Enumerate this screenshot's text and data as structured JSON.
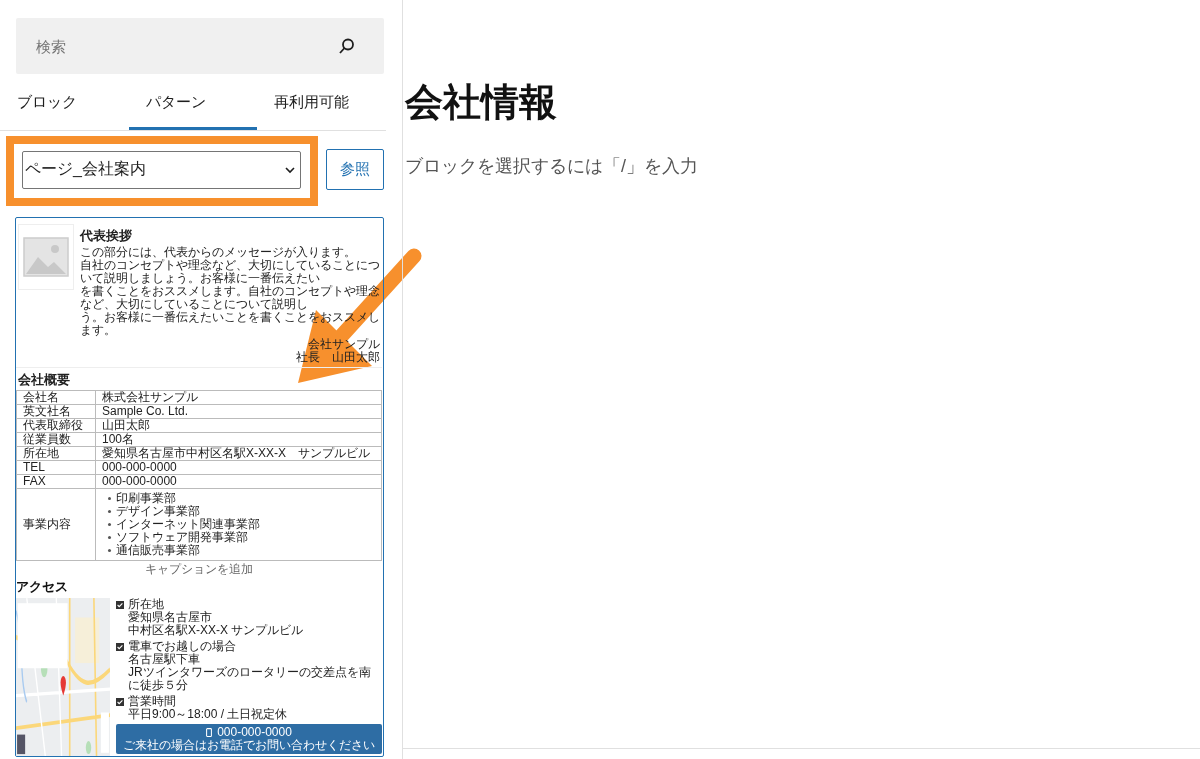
{
  "search": {
    "placeholder": "検索"
  },
  "tabs": [
    {
      "label": "ブロック",
      "selected": false
    },
    {
      "label": "パターン",
      "selected": true
    },
    {
      "label": "再利用可能",
      "selected": false
    }
  ],
  "pattern_category": {
    "value": "ページ_会社案内",
    "highlighted": true
  },
  "browse_button": "参照",
  "pattern_preview": {
    "pointed_at": true,
    "greeting": {
      "title": "代表挨拶",
      "paragraphs": [
        "この部分には、代表からのメッセージが入ります。",
        "自社のコンセプトや理念など、大切にしていることについて説明しましょう。お客様に一番伝えたい",
        "を書くことをおススメします。自社のコンセプトや理念など、大切にしていることについて説明し",
        "う。お客様に一番伝えたいことを書くことをおススメします。"
      ],
      "signature": [
        "会社サンプル",
        "社長　山田太郎"
      ]
    },
    "overview": {
      "title": "会社概要",
      "rows": [
        {
          "label": "会社名",
          "value": "株式会社サンプル"
        },
        {
          "label": "英文社名",
          "value": "Sample Co. Ltd."
        },
        {
          "label": "代表取締役",
          "value": "山田太郎"
        },
        {
          "label": "従業員数",
          "value": "100名"
        },
        {
          "label": "所在地",
          "value": "愛知県名古屋市中村区名駅X-XX-X　サンプルビル"
        },
        {
          "label": "TEL",
          "value": "000-000-0000"
        },
        {
          "label": "FAX",
          "value": "000-000-0000"
        },
        {
          "label": "事業内容",
          "items": [
            "印刷事業部",
            "デザイン事業部",
            "インターネット関連事業部",
            "ソフトウェア開発事業部",
            "通信販売事業部"
          ]
        }
      ],
      "caption": "キャプションを追加"
    },
    "access": {
      "title": "アクセス",
      "details": [
        {
          "heading": "所在地",
          "lines": [
            "愛知県名古屋市",
            "中村区名駅X-XX-X サンプルビル"
          ]
        },
        {
          "heading": "電車でお越しの場合",
          "lines": [
            "名古屋駅下車",
            "JRツインタワーズのロータリーの交差点を南に徒歩５分"
          ]
        },
        {
          "heading": "営業時間",
          "lines": [
            "平日9:00～18:00 / 土日祝定休"
          ]
        }
      ],
      "phone_button": {
        "number": "000-000-0000",
        "note": "ご来社の場合はお電話でお問い合わせください"
      }
    }
  },
  "editor": {
    "title": "会社情報",
    "placeholder": "ブロックを選択するには「/」を入力"
  }
}
